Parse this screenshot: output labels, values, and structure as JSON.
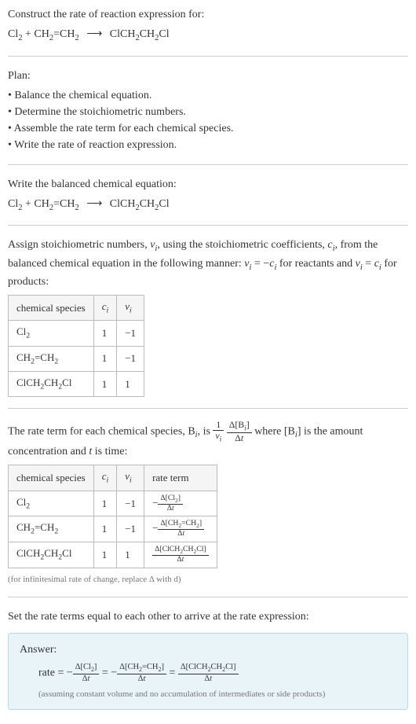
{
  "intro": {
    "prompt": "Construct the rate of reaction expression for:",
    "equation_lhs1": "Cl",
    "equation_lhs2": "CH",
    "equation_lhs2b": "=CH",
    "equation_rhs": "ClCH",
    "equation_rhs2": "CH",
    "equation_rhs3": "Cl"
  },
  "plan": {
    "heading": "Plan:",
    "items": [
      "Balance the chemical equation.",
      "Determine the stoichiometric numbers.",
      "Assemble the rate term for each chemical species.",
      "Write the rate of reaction expression."
    ]
  },
  "balanced": {
    "heading": "Write the balanced chemical equation:"
  },
  "stoich": {
    "text1": "Assign stoichiometric numbers, ",
    "nu_i": "ν",
    "text2": ", using the stoichiometric coefficients, ",
    "c_i": "c",
    "text3": ", from the balanced chemical equation in the following manner: ",
    "eq1": " = −",
    "text4": " for reactants and ",
    "eq2": " = ",
    "text5": " for products:",
    "table": {
      "headers": [
        "chemical species",
        "cᵢ",
        "νᵢ"
      ],
      "rows": [
        {
          "species": "Cl₂",
          "c": "1",
          "nu": "−1"
        },
        {
          "species": "CH₂=CH₂",
          "c": "1",
          "nu": "−1"
        },
        {
          "species": "ClCH₂CH₂Cl",
          "c": "1",
          "nu": "1"
        }
      ]
    }
  },
  "rateterm": {
    "text1": "The rate term for each chemical species, B",
    "text2": ", is ",
    "text3": " where [B",
    "text4": "] is the amount concentration and ",
    "t": "t",
    "text5": " is time:",
    "frac1_num": "1",
    "frac1_den_nu": "ν",
    "frac2_num": "Δ[Bᵢ]",
    "frac2_den": "Δt",
    "table": {
      "headers": [
        "chemical species",
        "cᵢ",
        "νᵢ",
        "rate term"
      ],
      "rows": [
        {
          "species": "Cl₂",
          "c": "1",
          "nu": "−1",
          "num": "Δ[Cl₂]",
          "den": "Δt",
          "neg": "−"
        },
        {
          "species": "CH₂=CH₂",
          "c": "1",
          "nu": "−1",
          "num": "Δ[CH₂=CH₂]",
          "den": "Δt",
          "neg": "−"
        },
        {
          "species": "ClCH₂CH₂Cl",
          "c": "1",
          "nu": "1",
          "num": "Δ[ClCH₂CH₂Cl]",
          "den": "Δt",
          "neg": ""
        }
      ]
    },
    "note": "(for infinitesimal rate of change, replace Δ with d)"
  },
  "final": {
    "heading": "Set the rate terms equal to each other to arrive at the rate expression:"
  },
  "answer": {
    "label": "Answer:",
    "rate": "rate = ",
    "neg": "−",
    "eq": " = ",
    "t1_num": "Δ[Cl₂]",
    "t1_den": "Δt",
    "t2_num": "Δ[CH₂=CH₂]",
    "t2_den": "Δt",
    "t3_num": "Δ[ClCH₂CH₂Cl]",
    "t3_den": "Δt",
    "note": "(assuming constant volume and no accumulation of intermediates or side products)"
  },
  "sub2": "2",
  "sub_i": "i"
}
